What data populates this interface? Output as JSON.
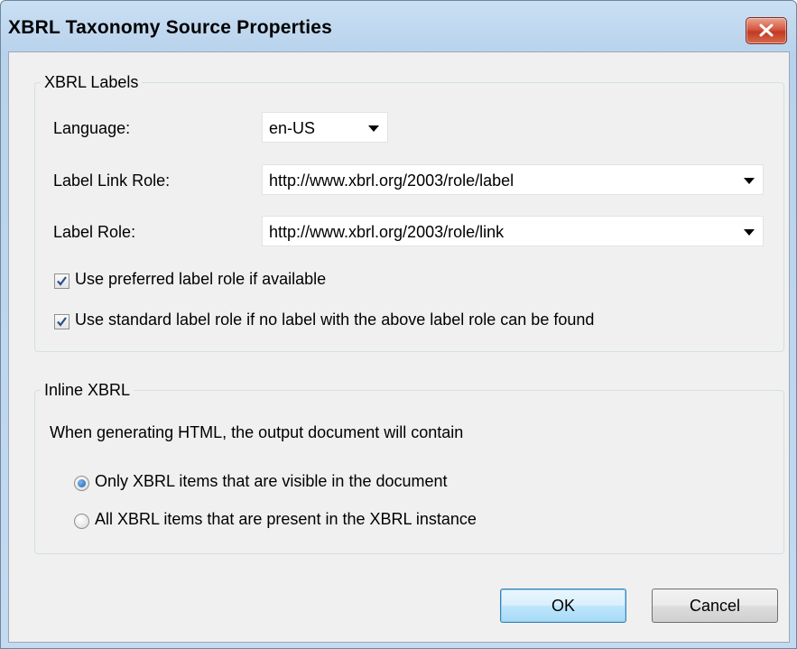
{
  "window": {
    "title": "XBRL Taxonomy Source Properties"
  },
  "xbrl_labels": {
    "group_label": "XBRL Labels",
    "language": {
      "label": "Language:",
      "value": "en-US"
    },
    "label_link_role": {
      "label": "Label Link Role:",
      "value": "http://www.xbrl.org/2003/role/label"
    },
    "label_role": {
      "label": "Label Role:",
      "value": "http://www.xbrl.org/2003/role/link"
    },
    "use_preferred": {
      "label": "Use preferred label role if available",
      "checked": true
    },
    "use_standard": {
      "label": "Use standard label role if no label with the above label role can be found",
      "checked": true
    }
  },
  "inline_xbrl": {
    "group_label": "Inline XBRL",
    "description": "When generating HTML, the output document will contain",
    "options": [
      {
        "label": "Only XBRL items that are visible in the document",
        "selected": true
      },
      {
        "label": "All XBRL items that are present in the XBRL instance",
        "selected": false
      }
    ]
  },
  "buttons": {
    "ok": "OK",
    "cancel": "Cancel"
  },
  "colors": {
    "accent": "#1a5fb4",
    "close": "#c13a22",
    "client_bg": "#f0f0f0"
  }
}
